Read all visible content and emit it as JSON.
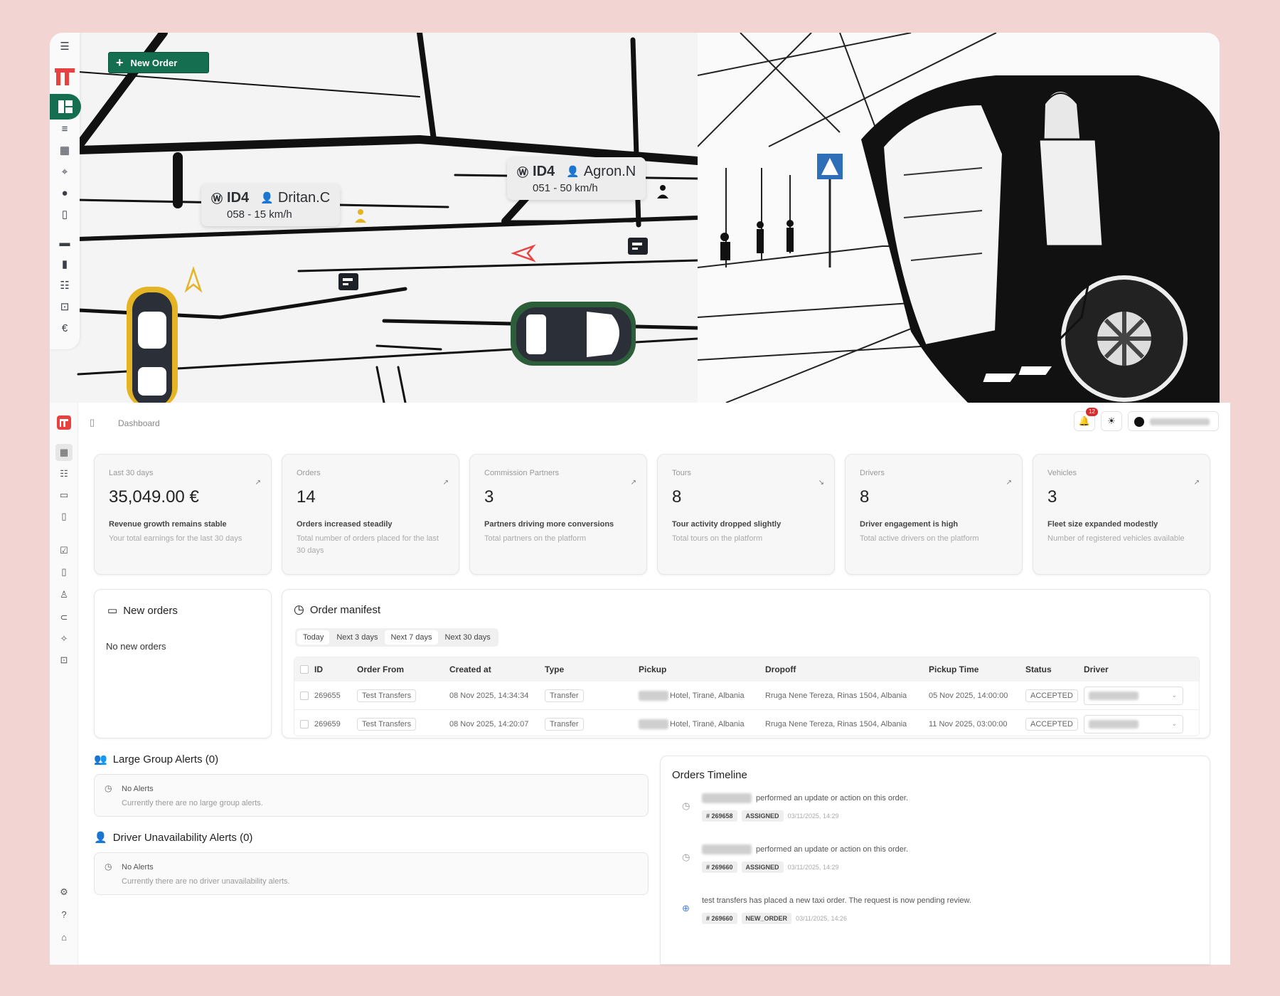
{
  "map": {
    "new_order_label": "New Order",
    "vehicles": [
      {
        "model": "ID4",
        "driver": "Dritan.C",
        "info": "058 - 15 km/h"
      },
      {
        "model": "ID4",
        "driver": "Agron.N",
        "info": "051 - 50 km/h"
      }
    ]
  },
  "header": {
    "breadcrumb": "Dashboard",
    "notification_count": "12"
  },
  "stats": [
    {
      "label": "Last 30 days",
      "value": "35,049.00 €",
      "trend": "Revenue growth remains stable",
      "desc": "Your total earnings for the last 30 days"
    },
    {
      "label": "Orders",
      "value": "14",
      "trend": "Orders increased steadily",
      "desc": "Total number of orders placed for the last 30 days"
    },
    {
      "label": "Commission Partners",
      "value": "3",
      "trend": "Partners driving more conversions",
      "desc": "Total partners on the platform"
    },
    {
      "label": "Tours",
      "value": "8",
      "trend": "Tour activity dropped slightly",
      "desc": "Total tours on the platform"
    },
    {
      "label": "Drivers",
      "value": "8",
      "trend": "Driver engagement is high",
      "desc": "Total active drivers on the platform"
    },
    {
      "label": "Vehicles",
      "value": "3",
      "trend": "Fleet size expanded modestly",
      "desc": "Number of registered vehicles available"
    }
  ],
  "new_orders": {
    "title": "New orders",
    "empty": "No new orders"
  },
  "manifest": {
    "title": "Order manifest",
    "tabs": [
      "Today",
      "Next 3 days",
      "Next 7 days",
      "Next 30 days"
    ],
    "columns": [
      "ID",
      "Order From",
      "Created at",
      "Type",
      "Pickup",
      "Dropoff",
      "Pickup Time",
      "Status",
      "Driver"
    ],
    "rows": [
      {
        "id": "269655",
        "from": "Test Transfers",
        "created": "08 Nov 2025, 14:34:34",
        "type": "Transfer",
        "pickup": "Hotel, Tiranë, Albania",
        "dropoff": "Rruga Nene Tereza, Rinas 1504, Albania",
        "pickup_time": "05 Nov 2025, 14:00:00",
        "status": "ACCEPTED"
      },
      {
        "id": "269659",
        "from": "Test Transfers",
        "created": "08 Nov 2025, 14:20:07",
        "type": "Transfer",
        "pickup": "Hotel, Tiranë, Albania",
        "dropoff": "Rruga Nene Tereza, Rinas 1504, Albania",
        "pickup_time": "11 Nov 2025, 03:00:00",
        "status": "ACCEPTED"
      }
    ]
  },
  "alerts": [
    {
      "title": "Large Group Alerts (0)",
      "heading": "No Alerts",
      "text": "Currently there are no large group alerts."
    },
    {
      "title": "Driver Unavailability Alerts (0)",
      "heading": "No Alerts",
      "text": "Currently there are no driver unavailability alerts."
    }
  ],
  "timeline": {
    "title": "Orders Timeline",
    "items": [
      {
        "text": "performed an update or action on this order.",
        "order": "# 269658",
        "event": "ASSIGNED",
        "time": "03/11/2025, 14:29"
      },
      {
        "text": "performed an update or action on this order.",
        "order": "# 269660",
        "event": "ASSIGNED",
        "time": "03/11/2025, 14:29"
      },
      {
        "text": "test transfers has placed a new taxi order. The request is now pending review.",
        "order": "# 269660",
        "event": "NEW_ORDER",
        "time": "03/11/2025, 14:26"
      }
    ]
  },
  "colors": {
    "brand_green": "#156e4f",
    "brand_red": "#e84141",
    "page_bg": "#f2d4d2",
    "badge_red": "#d92b2b"
  }
}
